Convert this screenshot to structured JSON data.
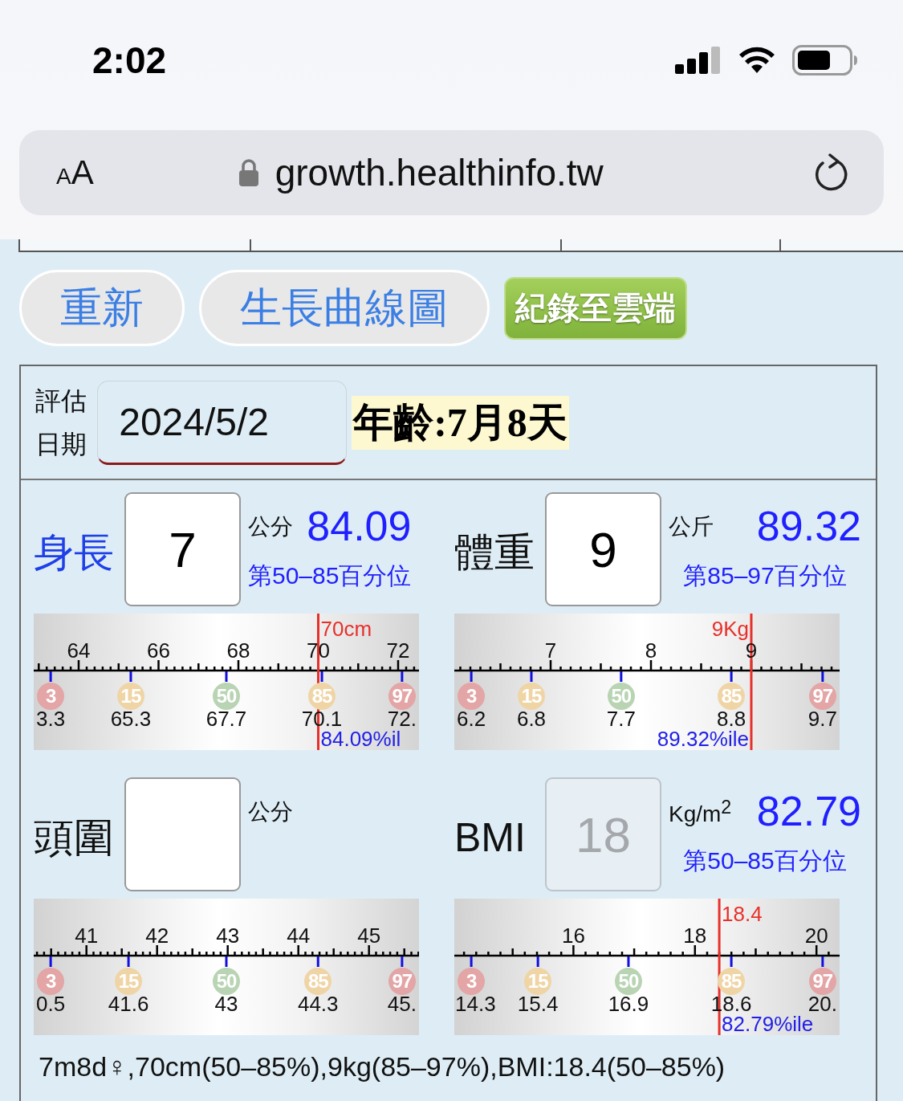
{
  "status_bar": {
    "time": "2:02"
  },
  "browser": {
    "text_size": "AA",
    "url": "growth.healthinfo.tw"
  },
  "buttons": [
    {
      "label": "重新",
      "kind": "pill"
    },
    {
      "label": "生長曲線圖",
      "kind": "pill"
    },
    {
      "label": "紀錄至雲端",
      "kind": "cloud"
    }
  ],
  "assessment": {
    "label": "評估日期",
    "date": "2024/5/2",
    "age": "年齡:7月8天"
  },
  "measurements": [
    {
      "label": "身長",
      "active": true,
      "value": "7",
      "disabled": false,
      "unit": "公分",
      "percentile": "84.09",
      "range": "第50–85百分位",
      "gauge": {
        "ticks": [
          "64",
          "66",
          "68",
          "70",
          "72"
        ],
        "markers": [
          {
            "percentile": "3",
            "value": "3.3",
            "color": "#e3a5a5"
          },
          {
            "percentile": "15",
            "value": "65.3",
            "color": "#efd5a6"
          },
          {
            "percentile": "50",
            "value": "67.7",
            "color": "#b8d4b3"
          },
          {
            "percentile": "85",
            "value": "70.1",
            "color": "#efd5a6"
          },
          {
            "percentile": "97",
            "value": "72.",
            "color": "#e3a5a5"
          }
        ],
        "reading": {
          "label": "70cm",
          "percentile": "84.09%il"
        }
      }
    },
    {
      "label": "體重",
      "active": false,
      "value": "9",
      "disabled": false,
      "unit": "公斤",
      "percentile": "89.32",
      "range": "第85–97百分位",
      "gauge": {
        "ticks": [
          "7",
          "8",
          "9"
        ],
        "markers": [
          {
            "percentile": "3",
            "value": "6.2",
            "color": "#e3a5a5"
          },
          {
            "percentile": "15",
            "value": "6.8",
            "color": "#efd5a6"
          },
          {
            "percentile": "50",
            "value": "7.7",
            "color": "#b8d4b3"
          },
          {
            "percentile": "85",
            "value": "8.8",
            "color": "#efd5a6"
          },
          {
            "percentile": "97",
            "value": "9.7",
            "color": "#e3a5a5"
          }
        ],
        "reading": {
          "label": "9Kg",
          "percentile": "89.32%ile"
        }
      }
    },
    {
      "label": "頭圍",
      "active": false,
      "disabled": false,
      "unit": "公分",
      "gauge": {
        "ticks": [
          "41",
          "42",
          "43",
          "44",
          "45"
        ],
        "markers": [
          {
            "percentile": "3",
            "value": "0.5",
            "color": "#e3a5a5"
          },
          {
            "percentile": "15",
            "value": "41.6",
            "color": "#efd5a6"
          },
          {
            "percentile": "50",
            "value": "43",
            "color": "#b8d4b3"
          },
          {
            "percentile": "85",
            "value": "44.3",
            "color": "#efd5a6"
          },
          {
            "percentile": "97",
            "value": "45.",
            "color": "#e3a5a5"
          }
        ]
      }
    },
    {
      "label": "BMI",
      "active": false,
      "value": "18",
      "disabled": true,
      "unit": "Kg/m$^{2}$",
      "percentile": "82.79",
      "range": "第50–85百分位",
      "gauge": {
        "ticks": [
          "16",
          "18",
          "20"
        ],
        "markers": [
          {
            "percentile": "3",
            "value": "14.3",
            "color": "#e3a5a5"
          },
          {
            "percentile": "15",
            "value": "15.4",
            "color": "#efd5a6"
          },
          {
            "percentile": "50",
            "value": "16.9",
            "color": "#b8d4b3"
          },
          {
            "percentile": "85",
            "value": "18.6",
            "color": "#efd5a6"
          },
          {
            "percentile": "97",
            "value": "20.",
            "color": "#e3a5a5"
          }
        ],
        "reading": {
          "label": "18.4",
          "percentile": "82.79%ile"
        }
      }
    }
  ],
  "summary": "7m8d♀,70cm(50–85%),9kg(85–97%),BMI:18.4(50–85%)"
}
